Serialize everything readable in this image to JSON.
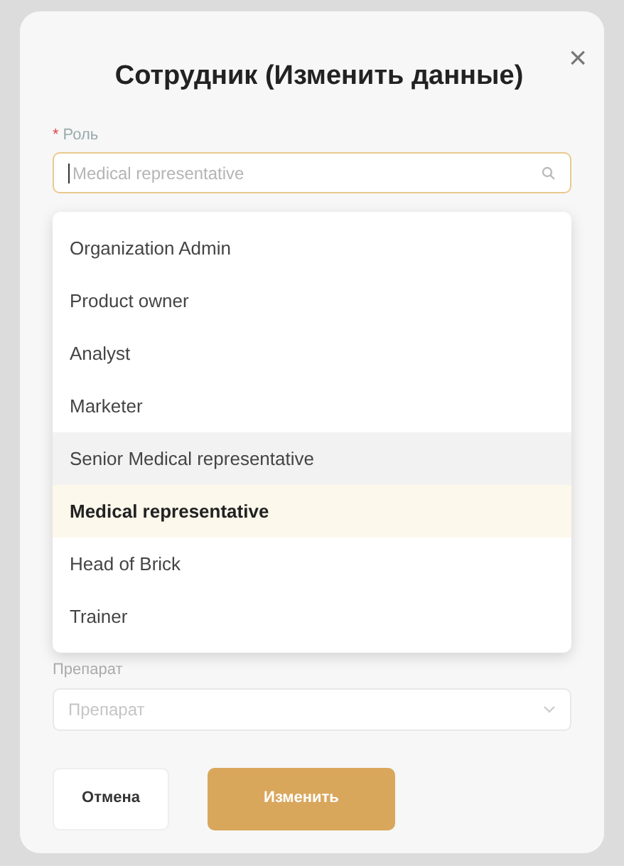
{
  "dialog": {
    "title": "Сотрудник (Изменить данные)",
    "close": "×"
  },
  "role_field": {
    "required_mark": "*",
    "label": "Роль",
    "placeholder": "Medical representative",
    "focused": true
  },
  "role_options": [
    {
      "label": "Organization Admin",
      "selected": false,
      "hovered": false
    },
    {
      "label": "Product owner",
      "selected": false,
      "hovered": false
    },
    {
      "label": "Analyst",
      "selected": false,
      "hovered": false
    },
    {
      "label": "Marketer",
      "selected": false,
      "hovered": false
    },
    {
      "label": "Senior Medical representative",
      "selected": false,
      "hovered": true
    },
    {
      "label": "Medical representative",
      "selected": true,
      "hovered": false
    },
    {
      "label": "Head of Brick",
      "selected": false,
      "hovered": false
    },
    {
      "label": "Trainer",
      "selected": false,
      "hovered": false
    }
  ],
  "drug_field": {
    "label": "Препарат",
    "placeholder": "Препарат"
  },
  "buttons": [
    {
      "label": "Отмена",
      "kind": "secondary"
    },
    {
      "label": "Изменить",
      "kind": "primary"
    }
  ]
}
